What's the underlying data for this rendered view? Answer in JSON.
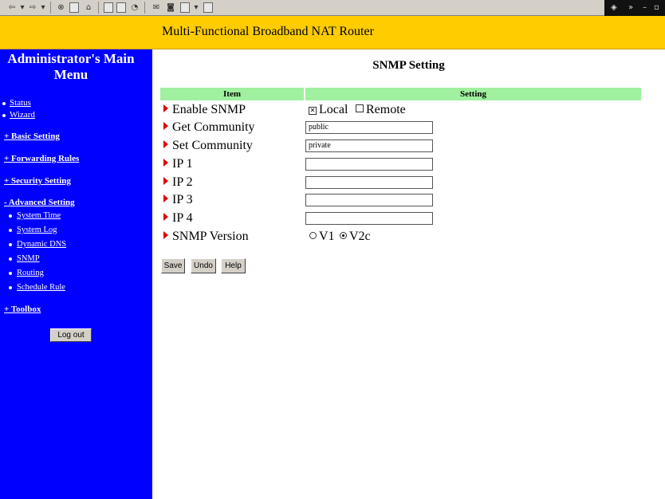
{
  "toolbar": {
    "icons": [
      "back",
      "forward",
      "stop",
      "refresh",
      "home",
      "search",
      "favorites",
      "history",
      "mail",
      "print",
      "edit",
      "discuss",
      "messenger"
    ],
    "right_link_label": "»"
  },
  "header": {
    "title": "Multi-Functional Broadband NAT Router"
  },
  "sidebar": {
    "title": "Administrator's Main Menu",
    "items": [
      {
        "label": "Status",
        "type": "link"
      },
      {
        "label": "Wizard",
        "type": "link"
      },
      {
        "label": "+ Basic Setting",
        "type": "section"
      },
      {
        "label": "+ Forwarding Rules",
        "type": "section"
      },
      {
        "label": "+ Security Setting",
        "type": "section"
      },
      {
        "label": "- Advanced Setting",
        "type": "section"
      },
      {
        "label": "System Time",
        "type": "sub"
      },
      {
        "label": "System Log",
        "type": "sub"
      },
      {
        "label": "Dynamic DNS",
        "type": "sub"
      },
      {
        "label": "SNMP",
        "type": "sub"
      },
      {
        "label": "Routing",
        "type": "sub"
      },
      {
        "label": "Schedule Rule",
        "type": "sub"
      },
      {
        "label": "+ Toolbox",
        "type": "section"
      }
    ],
    "logout_label": "Log out"
  },
  "main": {
    "title": "SNMP Setting",
    "table": {
      "headers": [
        "Item",
        "Setting"
      ],
      "rows": [
        {
          "label": "Enable SNMP"
        },
        {
          "label": "Get Community",
          "value": "public"
        },
        {
          "label": "Set Community",
          "value": "private"
        },
        {
          "label": "IP 1",
          "value": ""
        },
        {
          "label": "IP 2",
          "value": ""
        },
        {
          "label": "IP 3",
          "value": ""
        },
        {
          "label": "IP 4",
          "value": ""
        },
        {
          "label": "SNMP Version"
        }
      ]
    },
    "enable_snmp": {
      "local_label": "Local",
      "local_checked": true,
      "remote_label": "Remote",
      "remote_checked": false
    },
    "snmp_version": {
      "v1_label": "V1",
      "v2c_label": "V2c",
      "selected": "V2c"
    },
    "buttons": {
      "save": "Save",
      "undo": "Undo",
      "help": "Help"
    }
  },
  "colors": {
    "header_bg": "#ffcc00",
    "sidebar_bg": "#0000ff",
    "table_header_bg": "#a0f0a0",
    "arrow": "#e00000"
  }
}
